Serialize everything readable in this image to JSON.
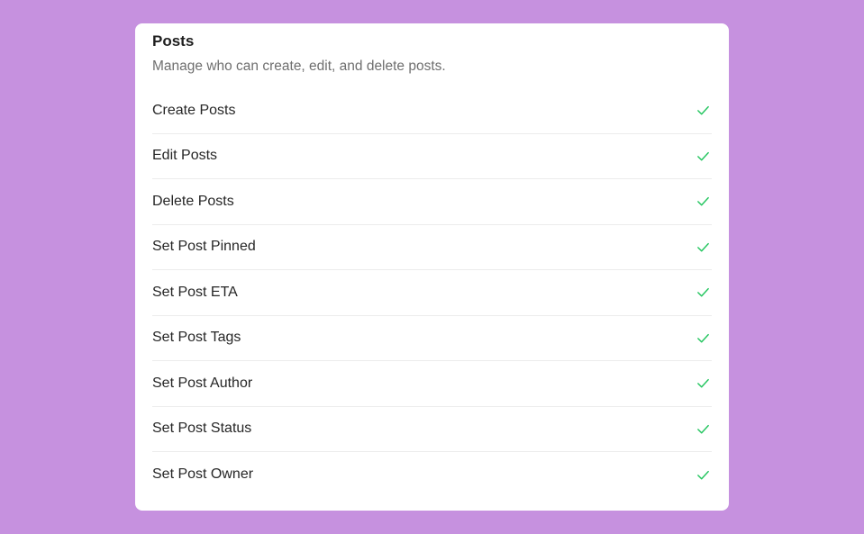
{
  "section": {
    "title": "Posts",
    "description": "Manage who can create, edit, and delete posts."
  },
  "permissions": [
    {
      "label": "Create Posts",
      "enabled": true,
      "icon": "check-icon"
    },
    {
      "label": "Edit Posts",
      "enabled": true,
      "icon": "check-icon"
    },
    {
      "label": "Delete Posts",
      "enabled": true,
      "icon": "check-icon"
    },
    {
      "label": "Set Post Pinned",
      "enabled": true,
      "icon": "check-icon"
    },
    {
      "label": "Set Post ETA",
      "enabled": true,
      "icon": "check-icon"
    },
    {
      "label": "Set Post Tags",
      "enabled": true,
      "icon": "check-icon"
    },
    {
      "label": "Set Post Author",
      "enabled": true,
      "icon": "check-icon"
    },
    {
      "label": "Set Post Status",
      "enabled": true,
      "icon": "check-icon"
    },
    {
      "label": "Set Post Owner",
      "enabled": true,
      "icon": "check-icon"
    }
  ],
  "colors": {
    "background": "#c691df",
    "card": "#ffffff",
    "check": "#22c55e",
    "divider": "#ececec"
  }
}
